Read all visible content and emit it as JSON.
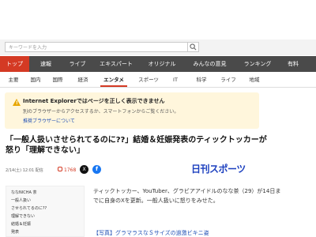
{
  "search": {
    "placeholder": "キーワードを入力"
  },
  "nav": [
    "トップ",
    "速報",
    "ライブ",
    "エキスパート",
    "オリジナル",
    "みんなの意見",
    "ランキング",
    "有料"
  ],
  "subnav": [
    "主要",
    "国内",
    "国際",
    "経済",
    "エンタメ",
    "スポーツ",
    "IT",
    "科学",
    "ライフ",
    "地域"
  ],
  "notice": {
    "icon_glyph": "!",
    "title": "Internet Explorerではページを正しく表示できません",
    "text": "別のブラウザーからアクセスするか、スマートフォンからご覧ください。",
    "link": "推奨ブラウザーについて"
  },
  "article": {
    "headline": "「一般人扱いさせられてるのに??」結婚＆妊娠発表のティックトッカーが怒り「理解できない」",
    "meta": "2/14(土) 12:01 配信",
    "comment_count": "1768",
    "x_glyph": "X",
    "fb_glyph": "f",
    "source_logo": "日刊スポーツ",
    "body": "ティックトッカー、YouTuber、グラビアアイドルのなな茶（29）が14日までに自身のXを更新。一般人扱いに怒りをみせた。",
    "related": "【写真】グラマラスなＳサイズの過激ビキニ姿"
  },
  "thumbnail_lines": [
    "ななNICHA 茶",
    "一般人扱い",
    "させられてるのに??",
    "理解できない",
    "結婚＆妊娠",
    "発表"
  ]
}
